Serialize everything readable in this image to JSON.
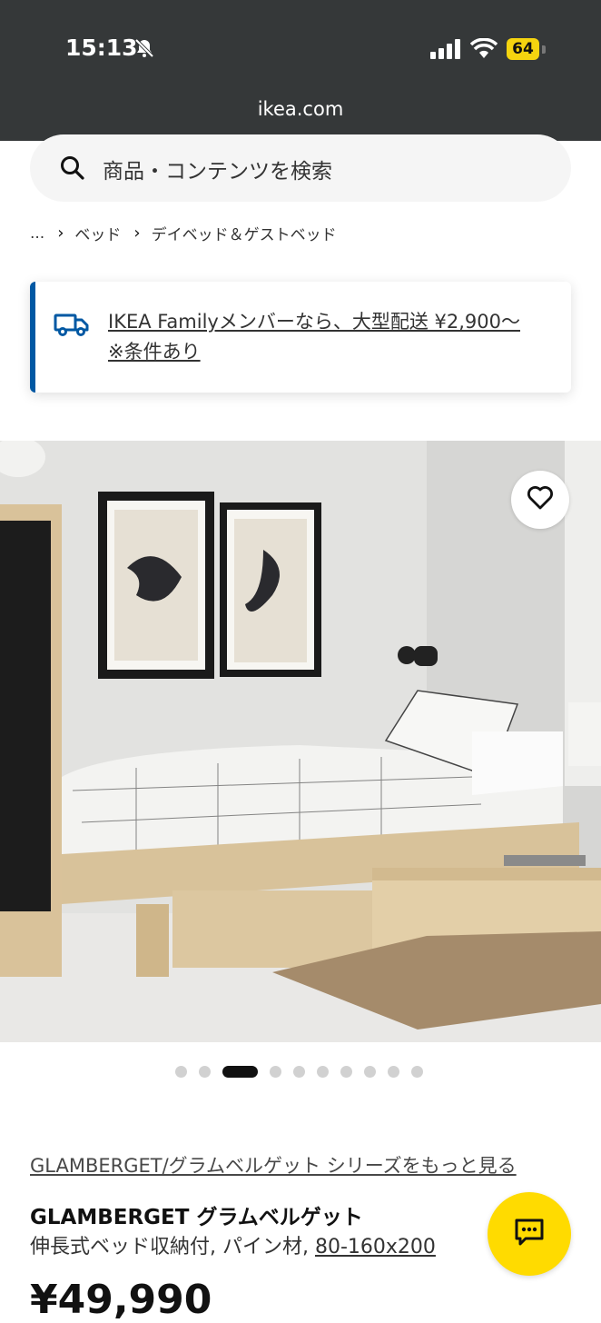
{
  "status_bar": {
    "time": "15:13",
    "battery": "64",
    "url": "ikea.com"
  },
  "search": {
    "placeholder": "商品・コンテンツを検索"
  },
  "breadcrumb": {
    "items": [
      "...",
      "ベッド",
      "デイベッド＆ゲストベッド"
    ]
  },
  "promo": {
    "line1": "IKEA Familyメンバーなら、大型配送 ¥2,900〜",
    "line2": "※条件あり"
  },
  "gallery": {
    "total_images": 10,
    "active_index": 2
  },
  "product": {
    "series_link": "GLAMBERGET/グラムベルゲット シリーズをもっと見る",
    "name": "GLAMBERGET グラムベルゲット",
    "description": "伸長式ベッド収納付, パイン材, ",
    "size": "80-160x200",
    "price": "¥49,990"
  },
  "colors": {
    "status_bg": "#353839",
    "accent_blue": "#0058a3",
    "ikea_yellow": "#ffdb00"
  },
  "icons": [
    "bell-slash-icon",
    "signal-icon",
    "wifi-icon",
    "search-icon",
    "chevron-right-icon",
    "truck-icon",
    "heart-icon",
    "chat-icon"
  ]
}
